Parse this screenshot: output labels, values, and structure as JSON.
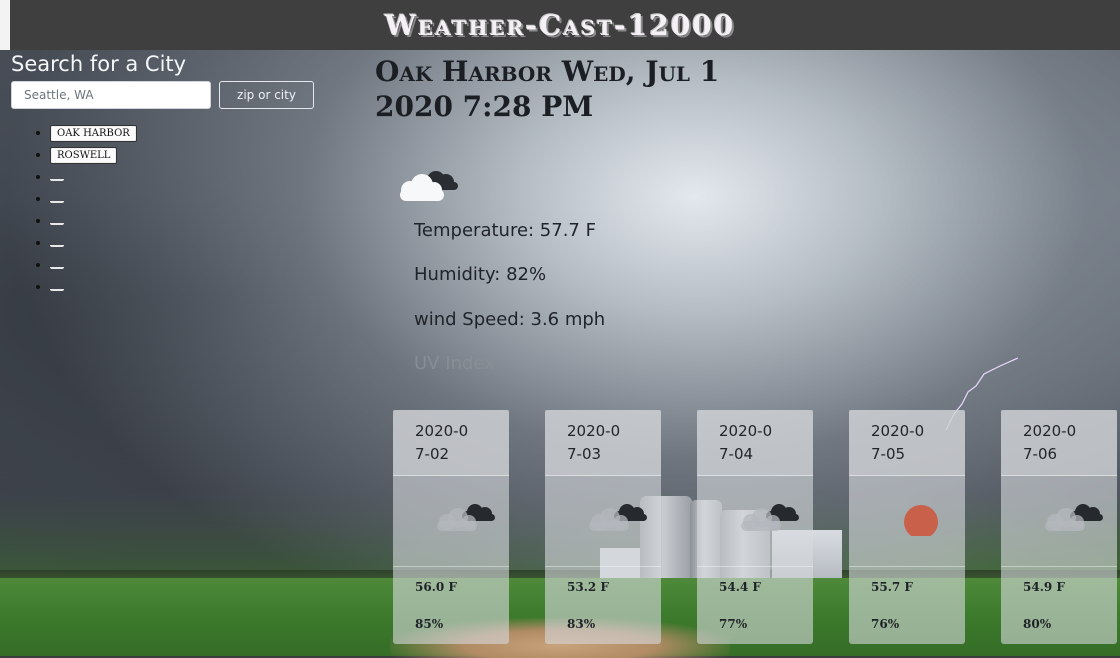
{
  "app": {
    "title": "Weather-Cast-12000"
  },
  "sidebar": {
    "heading": "Search for a City",
    "search_placeholder": "Seattle, WA",
    "search_button_label": "zip or city",
    "cities": [
      "OAK HARBOR",
      "ROSWELL"
    ],
    "empty_slots": 6
  },
  "current": {
    "city_date": "Oak Harbor Wed, Jul 1 2020 7:28 PM",
    "icon": "cloudy-icon",
    "temperature": "Temperature: 57.7 F",
    "humidity": "Humidity: 82%",
    "wind": "wind Speed: 3.6 mph",
    "uv": "UV Index"
  },
  "forecast": [
    {
      "date": "2020-07-02",
      "icon": "cloudy-icon",
      "temp": "56.0 F",
      "humidity": "85%"
    },
    {
      "date": "2020-07-03",
      "icon": "cloudy-icon",
      "temp": "53.2 F",
      "humidity": "83%"
    },
    {
      "date": "2020-07-04",
      "icon": "cloudy-icon",
      "temp": "54.4 F",
      "humidity": "77%"
    },
    {
      "date": "2020-07-05",
      "icon": "sun-icon",
      "temp": "55.7 F",
      "humidity": "76%"
    },
    {
      "date": "2020-07-06",
      "icon": "cloudy-icon",
      "temp": "54.9 F",
      "humidity": "80%"
    }
  ],
  "colors": {
    "header_bg": "#3f3f3f",
    "sun": "#c9604a"
  }
}
